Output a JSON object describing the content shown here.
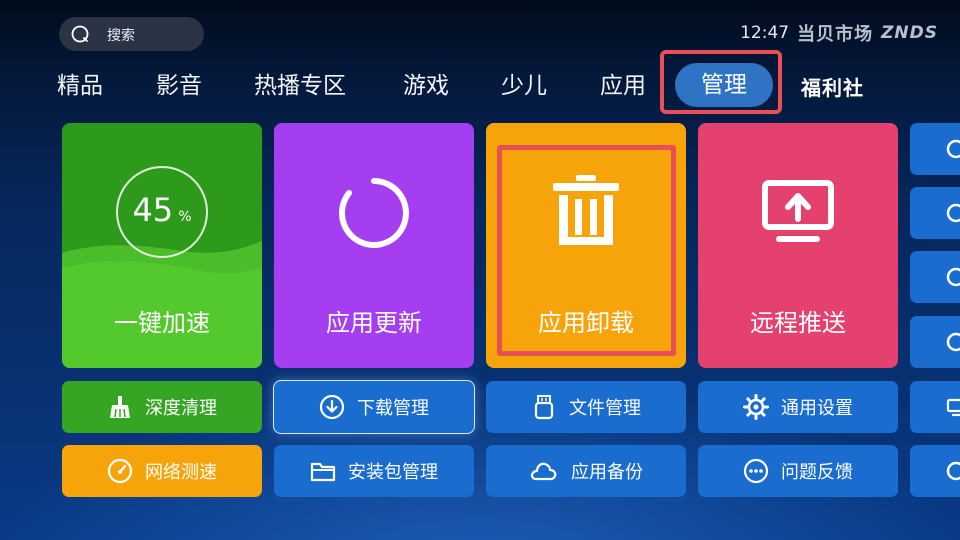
{
  "search": {
    "label": "搜索",
    "icon": "search-icon"
  },
  "status": {
    "time": "12:47",
    "brand_cn": "当贝市场",
    "brand_en": "ZNDS"
  },
  "nav": {
    "items": [
      "精品",
      "影音",
      "热播专区",
      "游戏",
      "少儿",
      "应用"
    ],
    "active": "管理",
    "welfare": "福利社"
  },
  "tiles": {
    "speedup": {
      "percent": "45",
      "unit": "%",
      "label": "一键加速"
    },
    "update": {
      "label": "应用更新",
      "icon": "refresh-icon"
    },
    "uninstall": {
      "label": "应用卸载",
      "icon": "trash-icon"
    },
    "push": {
      "label": "远程推送",
      "icon": "screen-upload-icon"
    }
  },
  "buttons": {
    "deep_clean": "深度清理",
    "download_mgr": "下载管理",
    "file_mgr": "文件管理",
    "general_settings": "通用设置",
    "net_speed": "网络测速",
    "package_mgr": "安装包管理",
    "app_backup": "应用备份",
    "feedback": "问题反馈"
  },
  "colors": {
    "green": "#37a524",
    "purple": "#a53ef0",
    "orange": "#f7a40b",
    "pink": "#e5416e",
    "blue": "#1a6ccf",
    "nav_active": "#2f73c4",
    "highlight": "#e94f57"
  }
}
